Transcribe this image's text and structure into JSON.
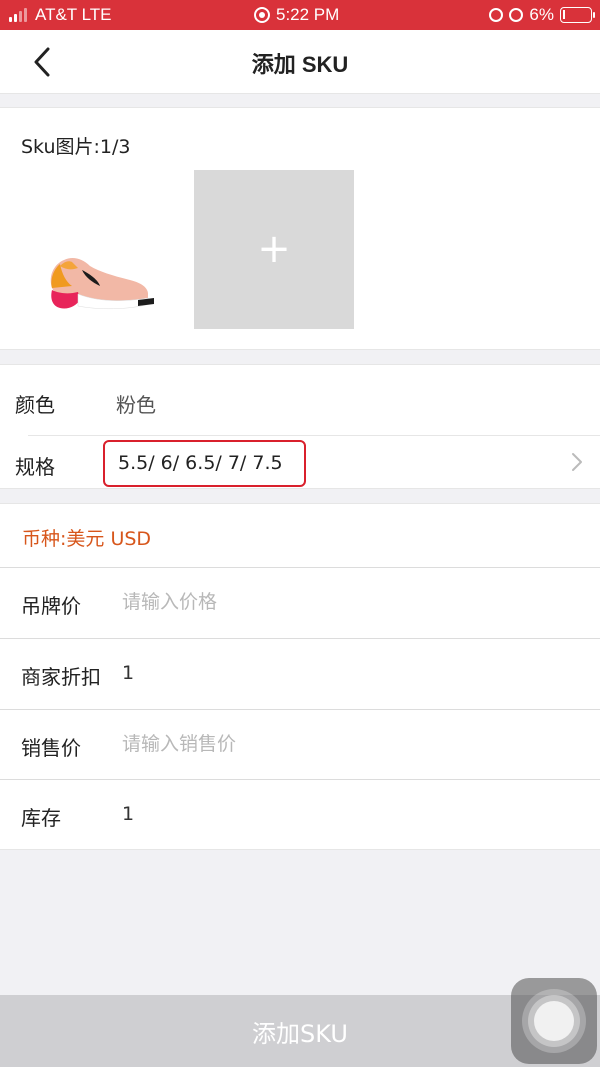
{
  "status_bar": {
    "carrier": "AT&T LTE",
    "time": "5:22 PM",
    "battery": "6%"
  },
  "nav": {
    "title": "添加 SKU"
  },
  "sku_images": {
    "label": "Sku图片:1/3",
    "add_symbol": "+"
  },
  "attributes": {
    "color_label": "颜色",
    "color_value": "粉色",
    "spec_label": "规格",
    "spec_value": "5.5/ 6/ 6.5/ 7/ 7.5"
  },
  "pricing": {
    "currency": "币种:美元 USD",
    "tag_price_label": "吊牌价",
    "tag_price_placeholder": "请输入价格",
    "discount_label": "商家折扣",
    "discount_value": "1",
    "sale_price_label": "销售价",
    "sale_price_placeholder": "请输入销售价",
    "stock_label": "库存",
    "stock_value": "1"
  },
  "footer": {
    "submit_label": "添加SKU"
  },
  "colors": {
    "status_bar": "#d9323a",
    "currency_text": "#d7561b",
    "highlight_border": "#d9202c",
    "submit_bg": "#cfcfd2"
  }
}
